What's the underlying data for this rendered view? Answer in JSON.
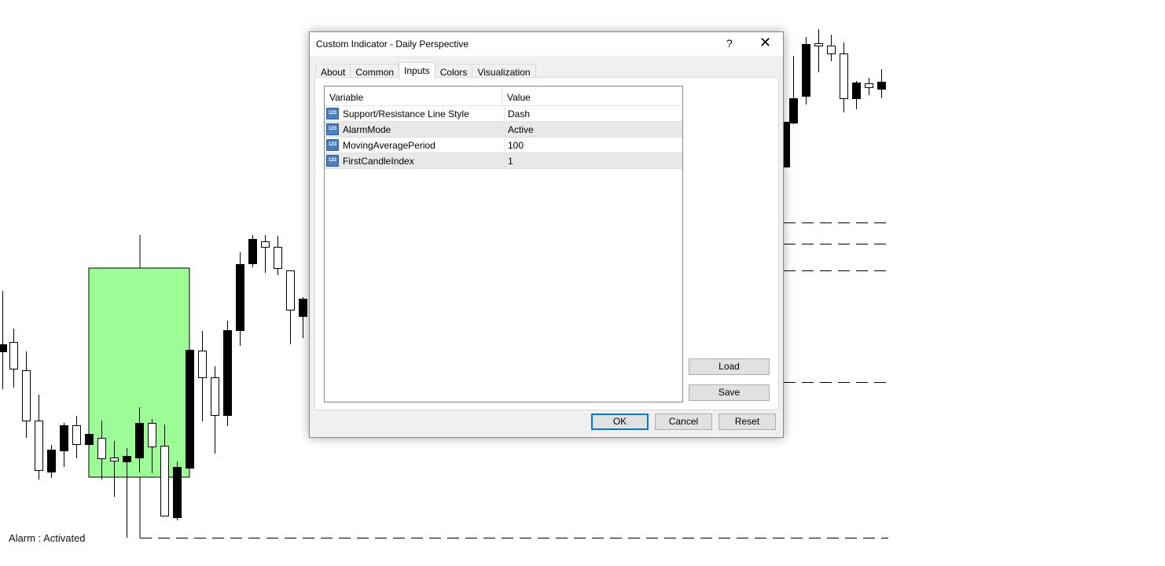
{
  "chart": {
    "alarm_text": "Alarm : Activated"
  },
  "dialog": {
    "title": "Custom Indicator - Daily Perspective",
    "help": "?",
    "close": "✕",
    "tabs": [
      "About",
      "Common",
      "Inputs",
      "Colors",
      "Visualization"
    ],
    "active_tab": "Inputs",
    "grid": {
      "headers": [
        "Variable",
        "Value"
      ],
      "rows": [
        {
          "icon": "123",
          "variable": "Support/Resistance Line Style",
          "value": "Dash"
        },
        {
          "icon": "123",
          "variable": "AlarmMode",
          "value": "Active"
        },
        {
          "icon": "123",
          "variable": "MovingAveragePeriod",
          "value": "100"
        },
        {
          "icon": "123",
          "variable": "FirstCandleIndex",
          "value": "1"
        }
      ]
    },
    "buttons": {
      "load": "Load",
      "save": "Save",
      "ok": "OK",
      "cancel": "Cancel",
      "reset": "Reset"
    }
  },
  "colors": {
    "zone": "#9cfc96",
    "accent": "#0078d7"
  }
}
